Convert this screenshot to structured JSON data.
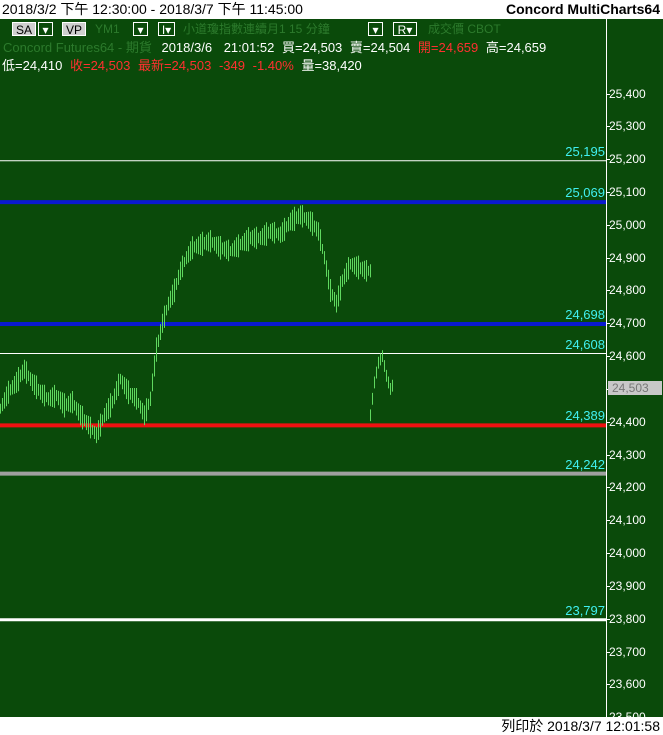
{
  "topbar": {
    "range": "2018/3/2 下午 12:30:00 - 2018/3/7 下午 11:45:00",
    "app": "Concord MultiCharts64"
  },
  "toolbar": {
    "sa": "SA",
    "vp": "VP",
    "symbol": "YM1",
    "interval_btn": "I",
    "desc": "小道瓊指數連續月1  15 分鐘",
    "r_btn": "R",
    "source": "成交價  CBOT"
  },
  "info": {
    "data_source": "Concord Futures64 - 期貨",
    "date": "2018/3/6",
    "time": "21:01:52",
    "bid": "買=24,503",
    "ask": "賣=24,504",
    "open": "開=24,659",
    "high": "高=24,659",
    "low": "低=24,410",
    "close": "收=24,503",
    "last": "最新=24,503",
    "change": "-349",
    "pct": "-1.40%",
    "volume": "量=38,420"
  },
  "colors": {
    "background": "#0a4a0a",
    "blue_line": "#0a1ad0",
    "red_line": "#ee1111",
    "gray_line": "#a0a0a0",
    "white_line": "#ffffff",
    "label": "#40f0f0"
  },
  "axis": {
    "ticks": [
      "25,400",
      "25,300",
      "25,200",
      "25,100",
      "25,000",
      "24,900",
      "24,800",
      "24,700",
      "24,600",
      "24,500",
      "24,400",
      "24,300",
      "24,200",
      "24,100",
      "24,000",
      "23,900",
      "23,800",
      "23,700",
      "23,600",
      "23,500"
    ],
    "current_price": "24,503"
  },
  "levels": [
    {
      "label": "25,195",
      "value": 25195,
      "style": "white-thin"
    },
    {
      "label": "25,069",
      "value": 25069,
      "style": "blue"
    },
    {
      "label": "24,698",
      "value": 24698,
      "style": "blue"
    },
    {
      "label": "24,608",
      "value": 24608,
      "style": "white-thin"
    },
    {
      "label": "24,389",
      "value": 24389,
      "style": "red"
    },
    {
      "label": "24,242",
      "value": 24242,
      "style": "gray"
    },
    {
      "label": "23,797",
      "value": 23797,
      "style": "white"
    }
  ],
  "footer": {
    "printed": "列印於 2018/3/7 12:01:58"
  }
}
